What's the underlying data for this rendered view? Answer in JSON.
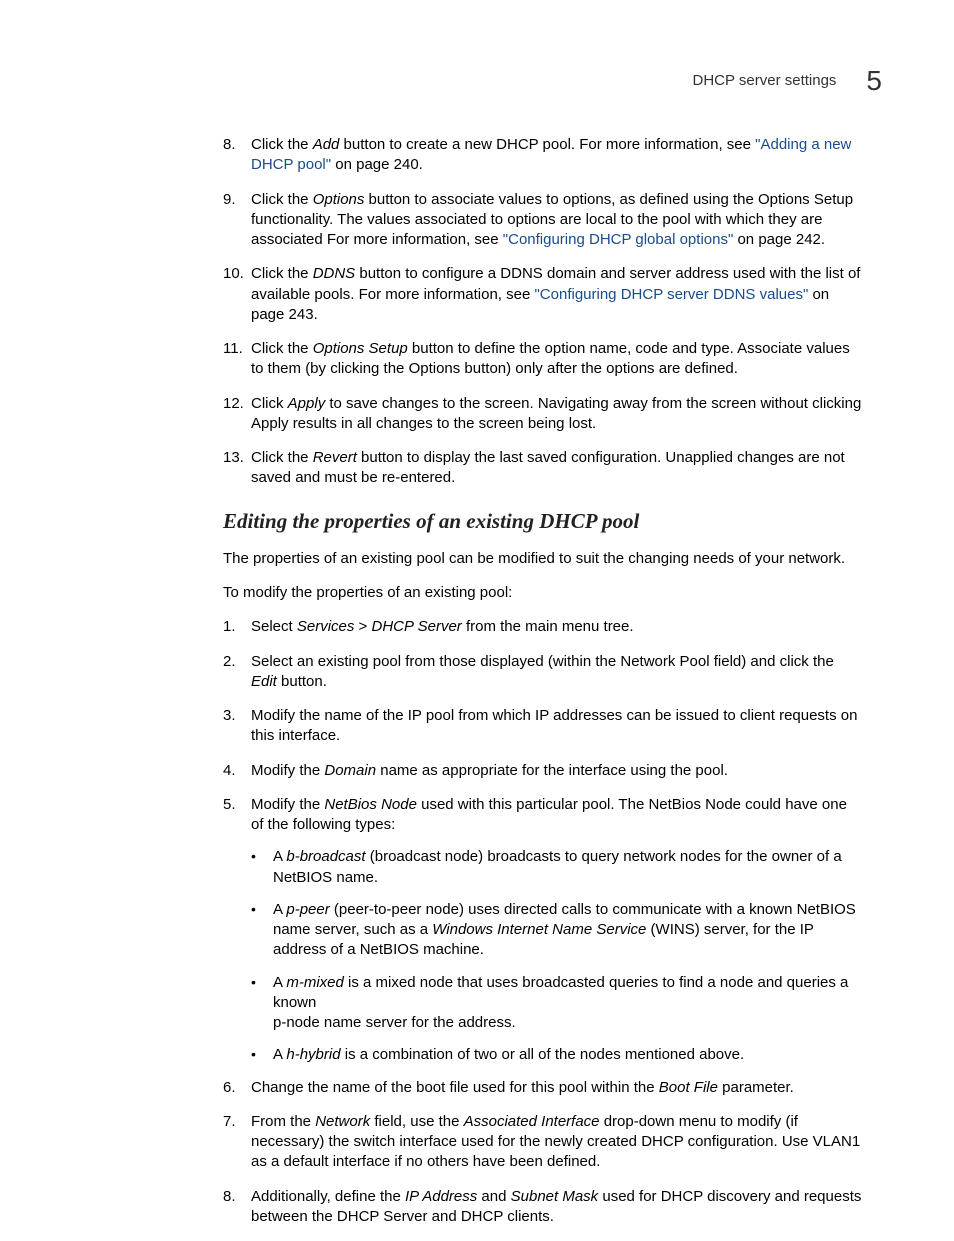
{
  "header": {
    "title": "DHCP server settings",
    "chapter": "5"
  },
  "list1": {
    "n8": "8.",
    "t8a": "Click the ",
    "t8b": "Add",
    "t8c": " button to create a new DHCP pool. For more information, see ",
    "t8d": "\"Adding a new DHCP pool\"",
    "t8e": " on page 240.",
    "n9": "9.",
    "t9a": "Click the ",
    "t9b": "Options",
    "t9c": " button to associate values to options, as defined using the Options Setup functionality. The values associated to options are local to the pool with which they are associated For more information, see ",
    "t9d": "\"Configuring DHCP global options\"",
    "t9e": " on page 242.",
    "n10": "10.",
    "t10a": "Click the ",
    "t10b": "DDNS",
    "t10c": " button to configure a DDNS domain and server address used with the list of available pools. For more information, see ",
    "t10d": "\"Configuring DHCP server DDNS values\"",
    "t10e": " on page 243.",
    "n11": "11.",
    "t11a": "Click the ",
    "t11b": "Options Setup",
    "t11c": " button to define the option name, code and type. Associate values to them (by clicking the Options button) only after the options are defined.",
    "n12": "12.",
    "t12a": "Click ",
    "t12b": "Apply",
    "t12c": " to save changes to the screen. Navigating away from the screen without clicking Apply results in all changes to the screen being lost.",
    "n13": "13.",
    "t13a": "Click the ",
    "t13b": "Revert",
    "t13c": " button to display the last saved configuration. Unapplied changes are not saved and must be re-entered."
  },
  "section": {
    "heading": "Editing the properties of an existing DHCP pool",
    "p1": "The properties of an existing pool can be modified to suit the changing needs of your network.",
    "p2": "To modify the properties of an existing pool:"
  },
  "list2": {
    "n1": "1.",
    "t1a": "Select ",
    "t1b": "Services",
    "t1c": " > ",
    "t1d": "DHCP Server",
    "t1e": " from the main menu tree.",
    "n2": "2.",
    "t2a": "Select an existing pool from those displayed (within the Network Pool field) and click the ",
    "t2b": "Edit",
    "t2c": " button.",
    "n3": "3.",
    "t3": "Modify the name of the IP pool from which IP addresses can be issued to client requests on this interface.",
    "n4": "4.",
    "t4a": "Modify the ",
    "t4b": "Domain",
    "t4c": " name as appropriate for the interface using the pool.",
    "n5": "5.",
    "t5a": "Modify the ",
    "t5b": "NetBios Node",
    "t5c": " used with this particular pool. The NetBios Node could have one of the following types:",
    "b1a": "A ",
    "b1b": "b-broadcast",
    "b1c": " (broadcast node) broadcasts to query network nodes for the owner of a NetBIOS name.",
    "b2a": "A ",
    "b2b": "p-peer",
    "b2c": " (peer-to-peer node) uses directed calls to communicate with a known NetBIOS name server, such as a ",
    "b2d": "Windows Internet Name Service",
    "b2e": " (WINS) server, for the IP address of a NetBIOS machine.",
    "b3a": "A ",
    "b3b": "m-mixed",
    "b3c": " is a mixed node that uses broadcasted queries to find a node and queries a known",
    "b3d": "p-node name server for the address.",
    "b4a": "A ",
    "b4b": "h-hybrid",
    "b4c": " is a combination of two or all of the nodes mentioned above.",
    "n6": "6.",
    "t6a": "Change the name of the boot file used for this pool within the ",
    "t6b": "Boot File",
    "t6c": " parameter.",
    "n7": "7.",
    "t7a": "From the ",
    "t7b": "Network",
    "t7c": " field, use the ",
    "t7d": "Associated Interface",
    "t7e": " drop-down menu to modify (if necessary) the switch interface used for the newly created DHCP configuration. Use VLAN1 as a default interface if no others have been defined.",
    "n8": "8.",
    "t8a": "Additionally, define the ",
    "t8b": "IP Address",
    "t8c": " and ",
    "t8d": "Subnet Mask",
    "t8e": " used for DHCP discovery and requests between the DHCP Server and DHCP clients."
  }
}
